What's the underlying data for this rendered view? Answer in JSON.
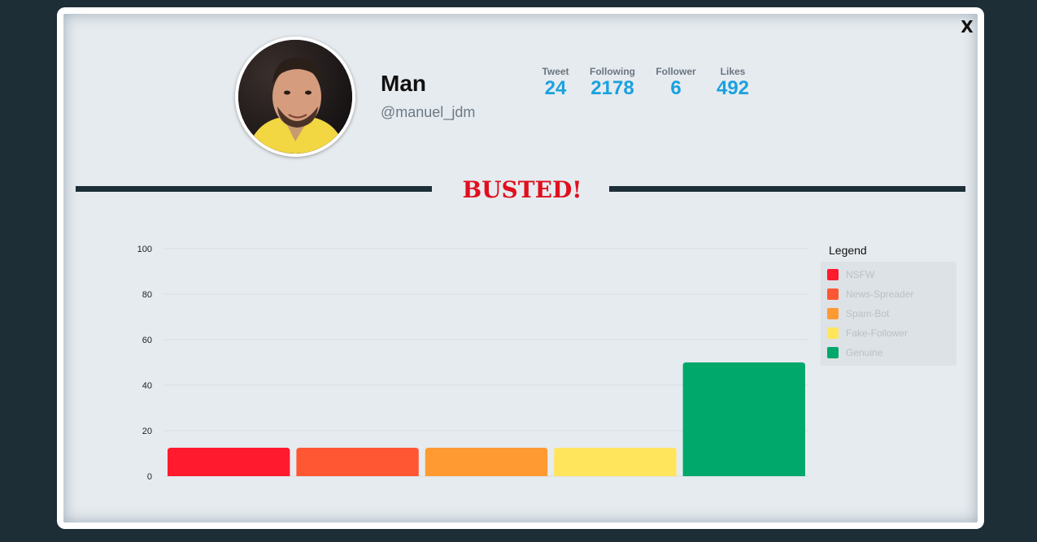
{
  "modal": {
    "close_label": "X"
  },
  "profile": {
    "name": "Man",
    "handle": "@manuel_jdm",
    "stats": [
      {
        "label": "Tweet",
        "value": "24"
      },
      {
        "label": "Following",
        "value": "2178"
      },
      {
        "label": "Follower",
        "value": "6"
      },
      {
        "label": "Likes",
        "value": "492"
      }
    ]
  },
  "verdict": "BUSTED!",
  "legend": {
    "title": "Legend",
    "items": [
      {
        "label": "NSFW",
        "color": "#ff1a2e"
      },
      {
        "label": "News-Spreader",
        "color": "#ff5733"
      },
      {
        "label": "Spam-Bot",
        "color": "#ff9a33"
      },
      {
        "label": "Fake-Follower",
        "color": "#ffe55c"
      },
      {
        "label": "Genuine",
        "color": "#00a86b"
      }
    ]
  },
  "chart_data": {
    "type": "bar",
    "categories": [
      "NSFW",
      "News-Spreader",
      "Spam-Bot",
      "Fake-Follower",
      "Genuine"
    ],
    "values": [
      12.5,
      12.5,
      12.5,
      12.5,
      50
    ],
    "colors": [
      "#ff1a2e",
      "#ff5733",
      "#ff9a33",
      "#ffe55c",
      "#00a86b"
    ],
    "yticks": [
      "0",
      "20",
      "40",
      "60",
      "80",
      "100"
    ],
    "ylim": [
      0,
      100
    ],
    "grid": true,
    "legend_position": "right"
  }
}
